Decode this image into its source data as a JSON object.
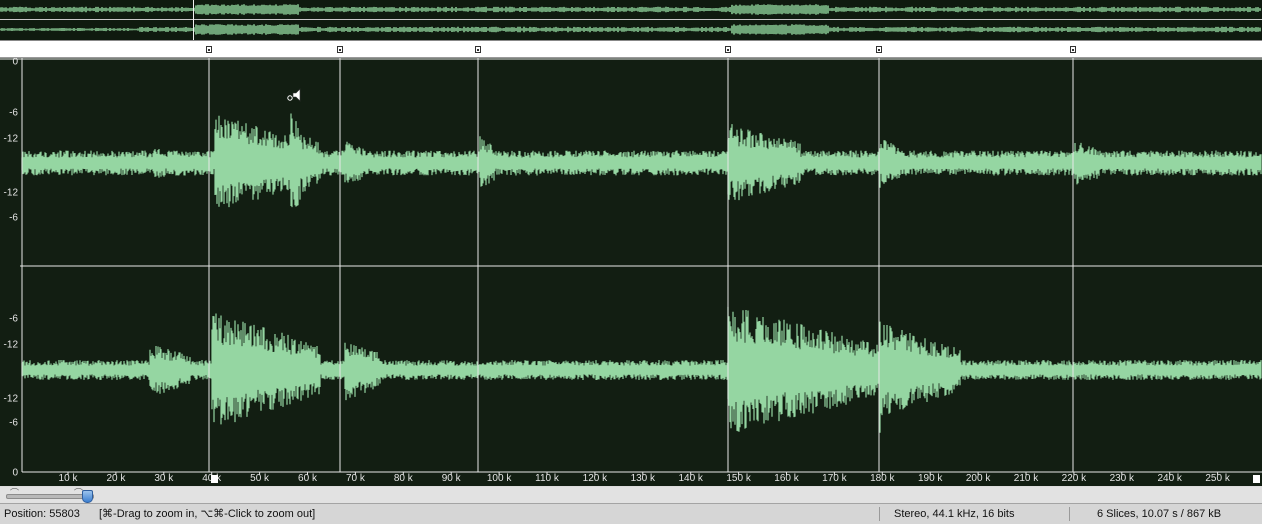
{
  "overview": {
    "color": "#8fd39b",
    "background": "#0f1a0f"
  },
  "waveform": {
    "background": "#121e12",
    "wave_color": "#95d6a2",
    "grid_color": "#e8e8e8",
    "ruler_labels": [
      "10 k",
      "20 k",
      "30 k",
      "40 k",
      "50 k",
      "60 k",
      "70 k",
      "80 k",
      "90 k",
      "100 k",
      "110 k",
      "120 k",
      "130 k",
      "140 k",
      "150 k",
      "160 k",
      "170 k",
      "180 k",
      "190 k",
      "200 k",
      "210 k",
      "220 k",
      "230 k",
      "240 k",
      "250 k"
    ],
    "amplitude_labels_top": [
      "0",
      "-6",
      "-12",
      "-12",
      "-6"
    ],
    "amplitude_labels_bottom": [
      "-6",
      "-12",
      "-12",
      "-6",
      "0"
    ],
    "slice_count": 6
  },
  "zoom": {
    "min_icon": "mountain-small-icon",
    "max_icon": "mountain-large-icon",
    "level": 0.9
  },
  "status": {
    "position": "Position: 55803",
    "hint": "[⌘-Drag to zoom in, ⌥⌘-Click to zoom out]",
    "format": "Stereo, 44.1 kHz, 16 bits",
    "summary": "6 Slices, 10.07 s / 867 kB"
  }
}
